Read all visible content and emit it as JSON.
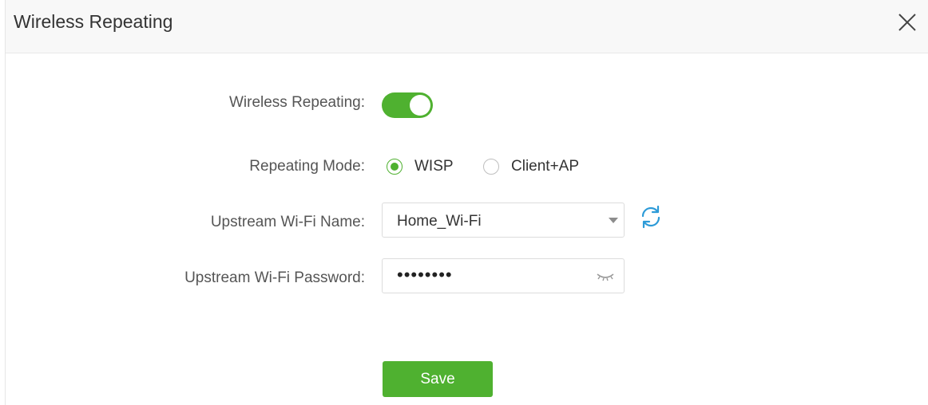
{
  "dialog": {
    "title": "Wireless Repeating",
    "close_icon": "close-icon"
  },
  "form": {
    "repeating_label": "Wireless Repeating:",
    "repeating_enabled": true,
    "mode_label": "Repeating Mode:",
    "mode_options": [
      {
        "label": "WISP",
        "selected": true
      },
      {
        "label": "Client+AP",
        "selected": false
      }
    ],
    "ssid_label": "Upstream Wi-Fi Name:",
    "ssid_value": "Home_Wi-Fi",
    "password_label": "Upstream Wi-Fi Password:",
    "password_value": "••••••••",
    "save_label": "Save"
  },
  "colors": {
    "accent": "#4fb130",
    "refresh_icon": "#2d9bd8",
    "header_bg": "#f8f8f8"
  },
  "icons": {
    "dropdown": "chevron-down-icon",
    "refresh": "refresh-icon",
    "password_visibility": "eye-closed-icon"
  }
}
